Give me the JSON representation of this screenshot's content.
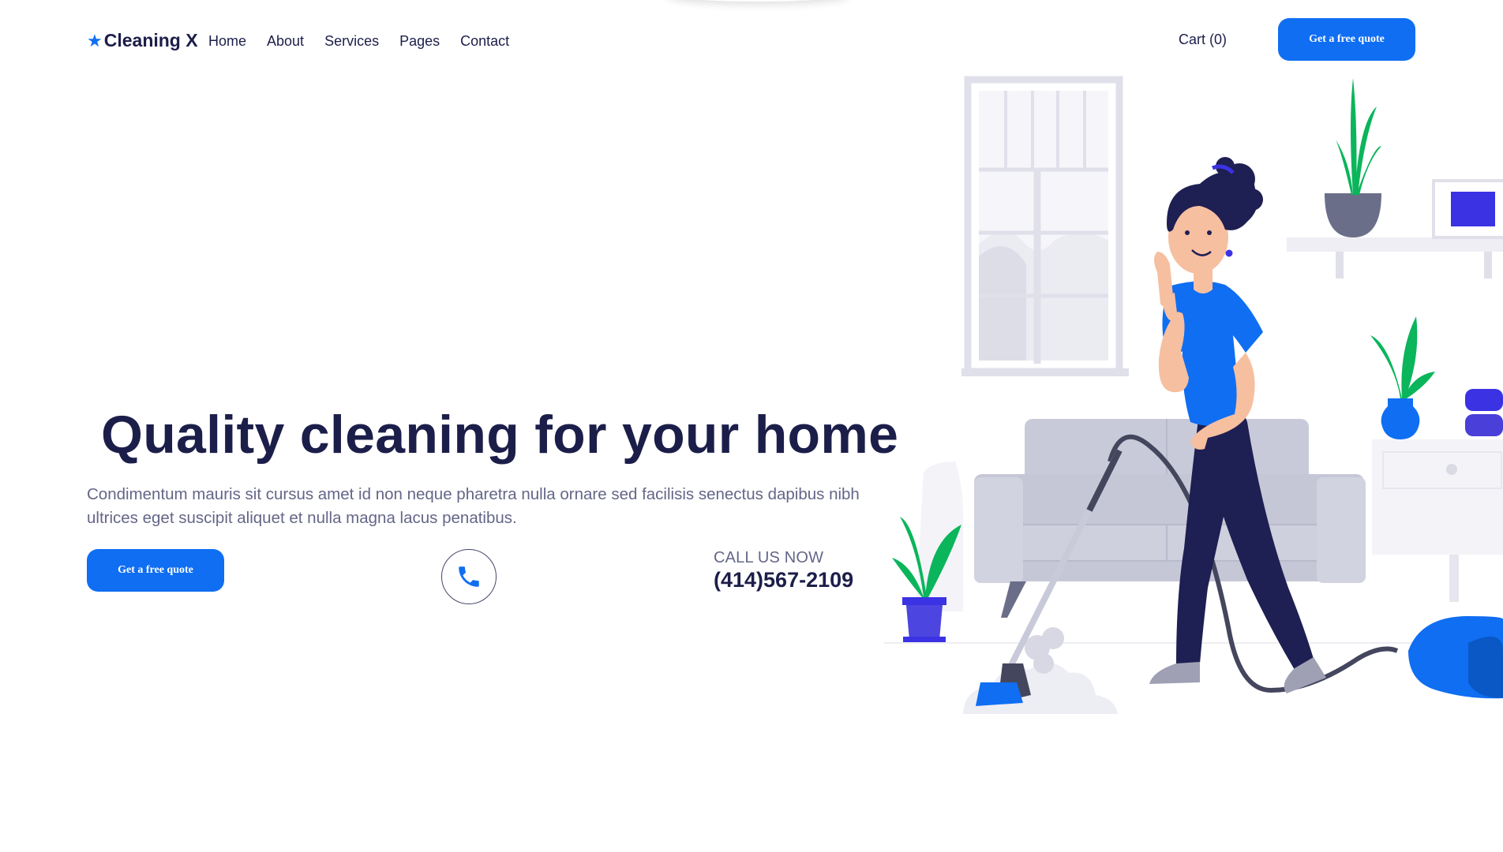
{
  "header": {
    "logo_star": "★",
    "logo_text": "Cleaning X",
    "nav": [
      "Home",
      "About",
      "Services",
      "Pages",
      "Contact"
    ],
    "cart_label": "Cart (0)",
    "cta_label": "Get a free quote"
  },
  "hero": {
    "title": "Quality cleaning for your home",
    "description": "Condimentum mauris sit cursus amet id non neque pharetra nulla ornare sed facilisis senectus dapibus nibh ultrices eget suscipit aliquet et nulla magna lacus penatibus.",
    "cta_label": "Get a free quote",
    "call_label": "CALL US NOW",
    "phone_number": "(414)567-2109",
    "phone_icon": "phone-icon"
  },
  "illustration": {
    "name": "woman-vacuuming-illustration"
  },
  "colors": {
    "primary": "#0f6ef2",
    "heading": "#1c1e4a",
    "body_text": "#646688",
    "accent_green": "#0bb55b",
    "accent_purple": "#3b32e3"
  }
}
